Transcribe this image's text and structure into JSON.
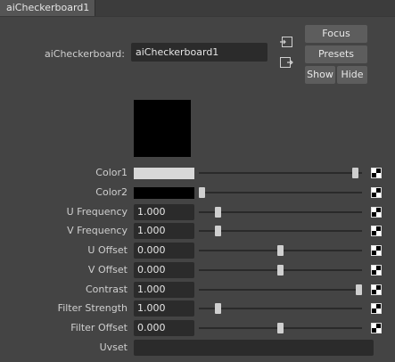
{
  "tab": {
    "label": "aiCheckerboard1"
  },
  "node": {
    "label": "aiCheckerboard:",
    "name": "aiCheckerboard1"
  },
  "buttons": {
    "focus": "Focus",
    "presets": "Presets",
    "show": "Show",
    "hide": "Hide"
  },
  "colors": {
    "color1": "#d8d8d8",
    "color2": "#000000",
    "swatch": "#000000"
  },
  "attributes": [
    {
      "label": "Color1",
      "type": "color",
      "slider": 0.98
    },
    {
      "label": "Color2",
      "type": "color",
      "slider": 0.0
    },
    {
      "label": "U Frequency",
      "type": "number",
      "value": "1.000",
      "slider": 0.1
    },
    {
      "label": "V Frequency",
      "type": "number",
      "value": "1.000",
      "slider": 0.1
    },
    {
      "label": "U Offset",
      "type": "number",
      "value": "0.000",
      "slider": 0.5
    },
    {
      "label": "V Offset",
      "type": "number",
      "value": "0.000",
      "slider": 0.5
    },
    {
      "label": "Contrast",
      "type": "number",
      "value": "1.000",
      "slider": 1.0
    },
    {
      "label": "Filter Strength",
      "type": "number",
      "value": "1.000",
      "slider": 0.1
    },
    {
      "label": "Filter Offset",
      "type": "number",
      "value": "0.000",
      "slider": 0.5
    }
  ],
  "uvset": {
    "label": "Uvset",
    "value": ""
  }
}
